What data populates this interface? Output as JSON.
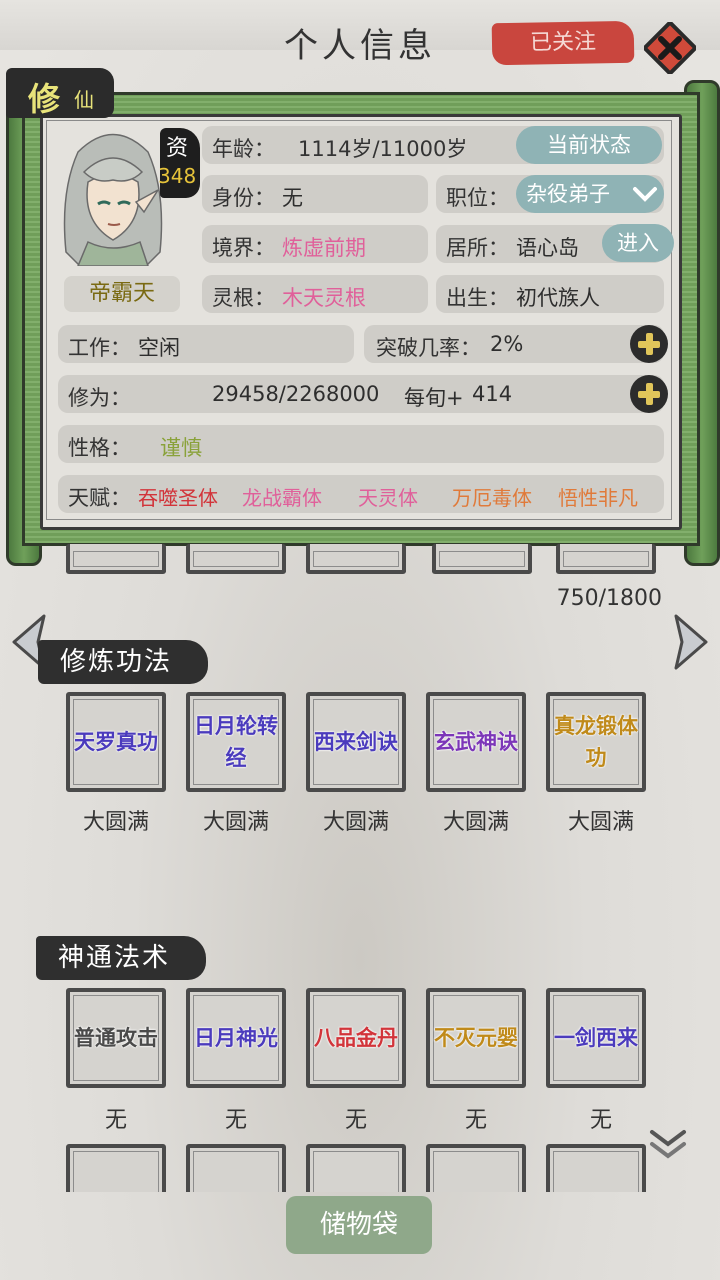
{
  "header": {
    "title": "个人信息",
    "follow_label": "已关注"
  },
  "profile": {
    "tag_big": "修",
    "tag_small": "仙",
    "aptitude_label": "资",
    "aptitude_value": "348",
    "name": "帝霸天",
    "age_label": "年龄：",
    "age_value": "1114岁/11000岁",
    "status_button": "当前状态",
    "identity_label": "身份：",
    "identity_value": "无",
    "position_label": "职位：",
    "position_value": "杂役弟子",
    "realm_label": "境界：",
    "realm_value": "炼虚前期",
    "residence_label": "居所：",
    "residence_value": "语心岛",
    "enter_button": "进入",
    "root_label": "灵根：",
    "root_value": "木天灵根",
    "birth_label": "出生：",
    "birth_value": "初代族人",
    "work_label": "工作：",
    "work_value": "空闲",
    "breakthrough_label": "突破几率：",
    "breakthrough_value": "2%",
    "cultivation_label": "修为：",
    "cultivation_value": "29458/2268000",
    "per_turn_label": "每旬+",
    "per_turn_value": "414",
    "personality_label": "性格：",
    "personality_value": "谨慎",
    "talent_label": "天赋：",
    "talents": [
      "吞噬圣体",
      "龙战霸体",
      "天灵体",
      "万厄毒体",
      "悟性非凡"
    ]
  },
  "colors": {
    "pink": "#e0609a",
    "olive": "#8aa23a",
    "red": "#d2343a",
    "orange": "#e07a3a",
    "blue": "#4b3bbd",
    "purple": "#7c36b8",
    "gold": "#c08a1a",
    "gray": "#4a4a4a"
  },
  "storage": {
    "count": "750/1800"
  },
  "techniques": {
    "title": "修炼功法",
    "items": [
      {
        "name": "天罗真功",
        "level": "大圆满",
        "color": "#4b3bbd"
      },
      {
        "name": "日月轮转经",
        "level": "大圆满",
        "color": "#4b3bbd"
      },
      {
        "name": "西来剑诀",
        "level": "大圆满",
        "color": "#4b3bbd"
      },
      {
        "name": "玄武神诀",
        "level": "大圆满",
        "color": "#7c36b8"
      },
      {
        "name": "真龙锻体功",
        "level": "大圆满",
        "color": "#c08a1a"
      }
    ]
  },
  "skills": {
    "title": "神通法术",
    "items": [
      {
        "name": "普通攻击",
        "level": "无",
        "color": "#4a4a4a"
      },
      {
        "name": "日月神光",
        "level": "无",
        "color": "#4b3bbd"
      },
      {
        "name": "八品金丹",
        "level": "无",
        "color": "#d2343a"
      },
      {
        "name": "不灭元婴",
        "level": "无",
        "color": "#c08a1a"
      },
      {
        "name": "一剑西来",
        "level": "无",
        "color": "#4b3bbd"
      }
    ]
  },
  "bag_button": "储物袋",
  "icons": {
    "close": "close-icon",
    "dropdown": "chevron-down-icon",
    "left": "arrow-left-icon",
    "right": "arrow-right-icon",
    "plus": "plus-icon",
    "scroll": "double-chevron-down-icon"
  }
}
